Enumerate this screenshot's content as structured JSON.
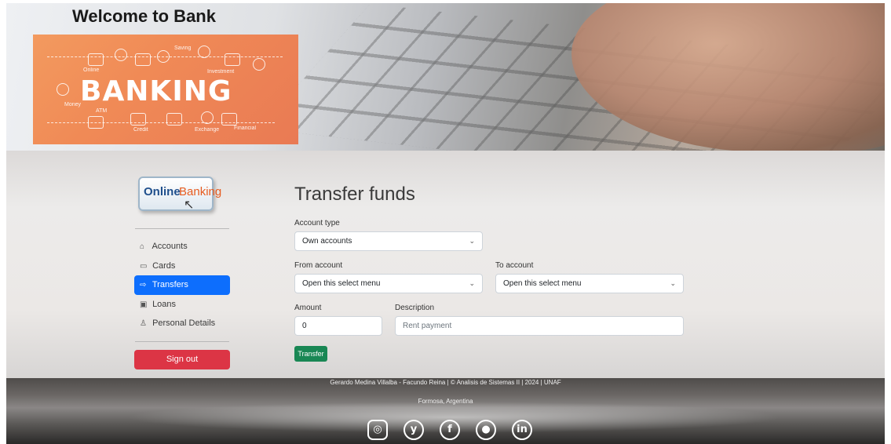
{
  "header": {
    "title": "Welcome to Bank",
    "banner": {
      "word": "BANKING",
      "small_labels": [
        "Online",
        "Saving",
        "Investment",
        "Money",
        "ATM",
        "Credit",
        "Exchange",
        "Financial"
      ]
    }
  },
  "sidebar": {
    "logo": {
      "part1": "Online",
      "part2": "Banking"
    },
    "items": [
      {
        "label": "Accounts",
        "icon": "bank-icon",
        "active": false
      },
      {
        "label": "Cards",
        "icon": "credit-card-icon",
        "active": false
      },
      {
        "label": "Transfers",
        "icon": "arrow-right-square-icon",
        "active": true
      },
      {
        "label": "Loans",
        "icon": "cash-icon",
        "active": false
      },
      {
        "label": "Personal Details",
        "icon": "person-icon",
        "active": false
      }
    ],
    "signout_label": "Sign out"
  },
  "form": {
    "title": "Transfer funds",
    "account_type": {
      "label": "Account type",
      "value": "Own accounts"
    },
    "from_account": {
      "label": "From account",
      "value": "Open this select menu"
    },
    "to_account": {
      "label": "To account",
      "value": "Open this select menu"
    },
    "amount": {
      "label": "Amount",
      "value": "0"
    },
    "description": {
      "label": "Description",
      "placeholder": "Rent payment"
    },
    "submit_label": "Transfer"
  },
  "footer": {
    "credit": "Gerardo Medina Villalba - Facundo Reina | © Analisis de Sistemas II | 2024 | UNAF",
    "location": "Formosa, Argentina",
    "social": [
      "instagram-icon",
      "twitter-icon",
      "facebook-icon",
      "github-icon",
      "linkedin-icon"
    ]
  },
  "colors": {
    "primary": "#0d6efd",
    "danger": "#dc3545",
    "success": "#198754",
    "banner": "#f08a56"
  }
}
